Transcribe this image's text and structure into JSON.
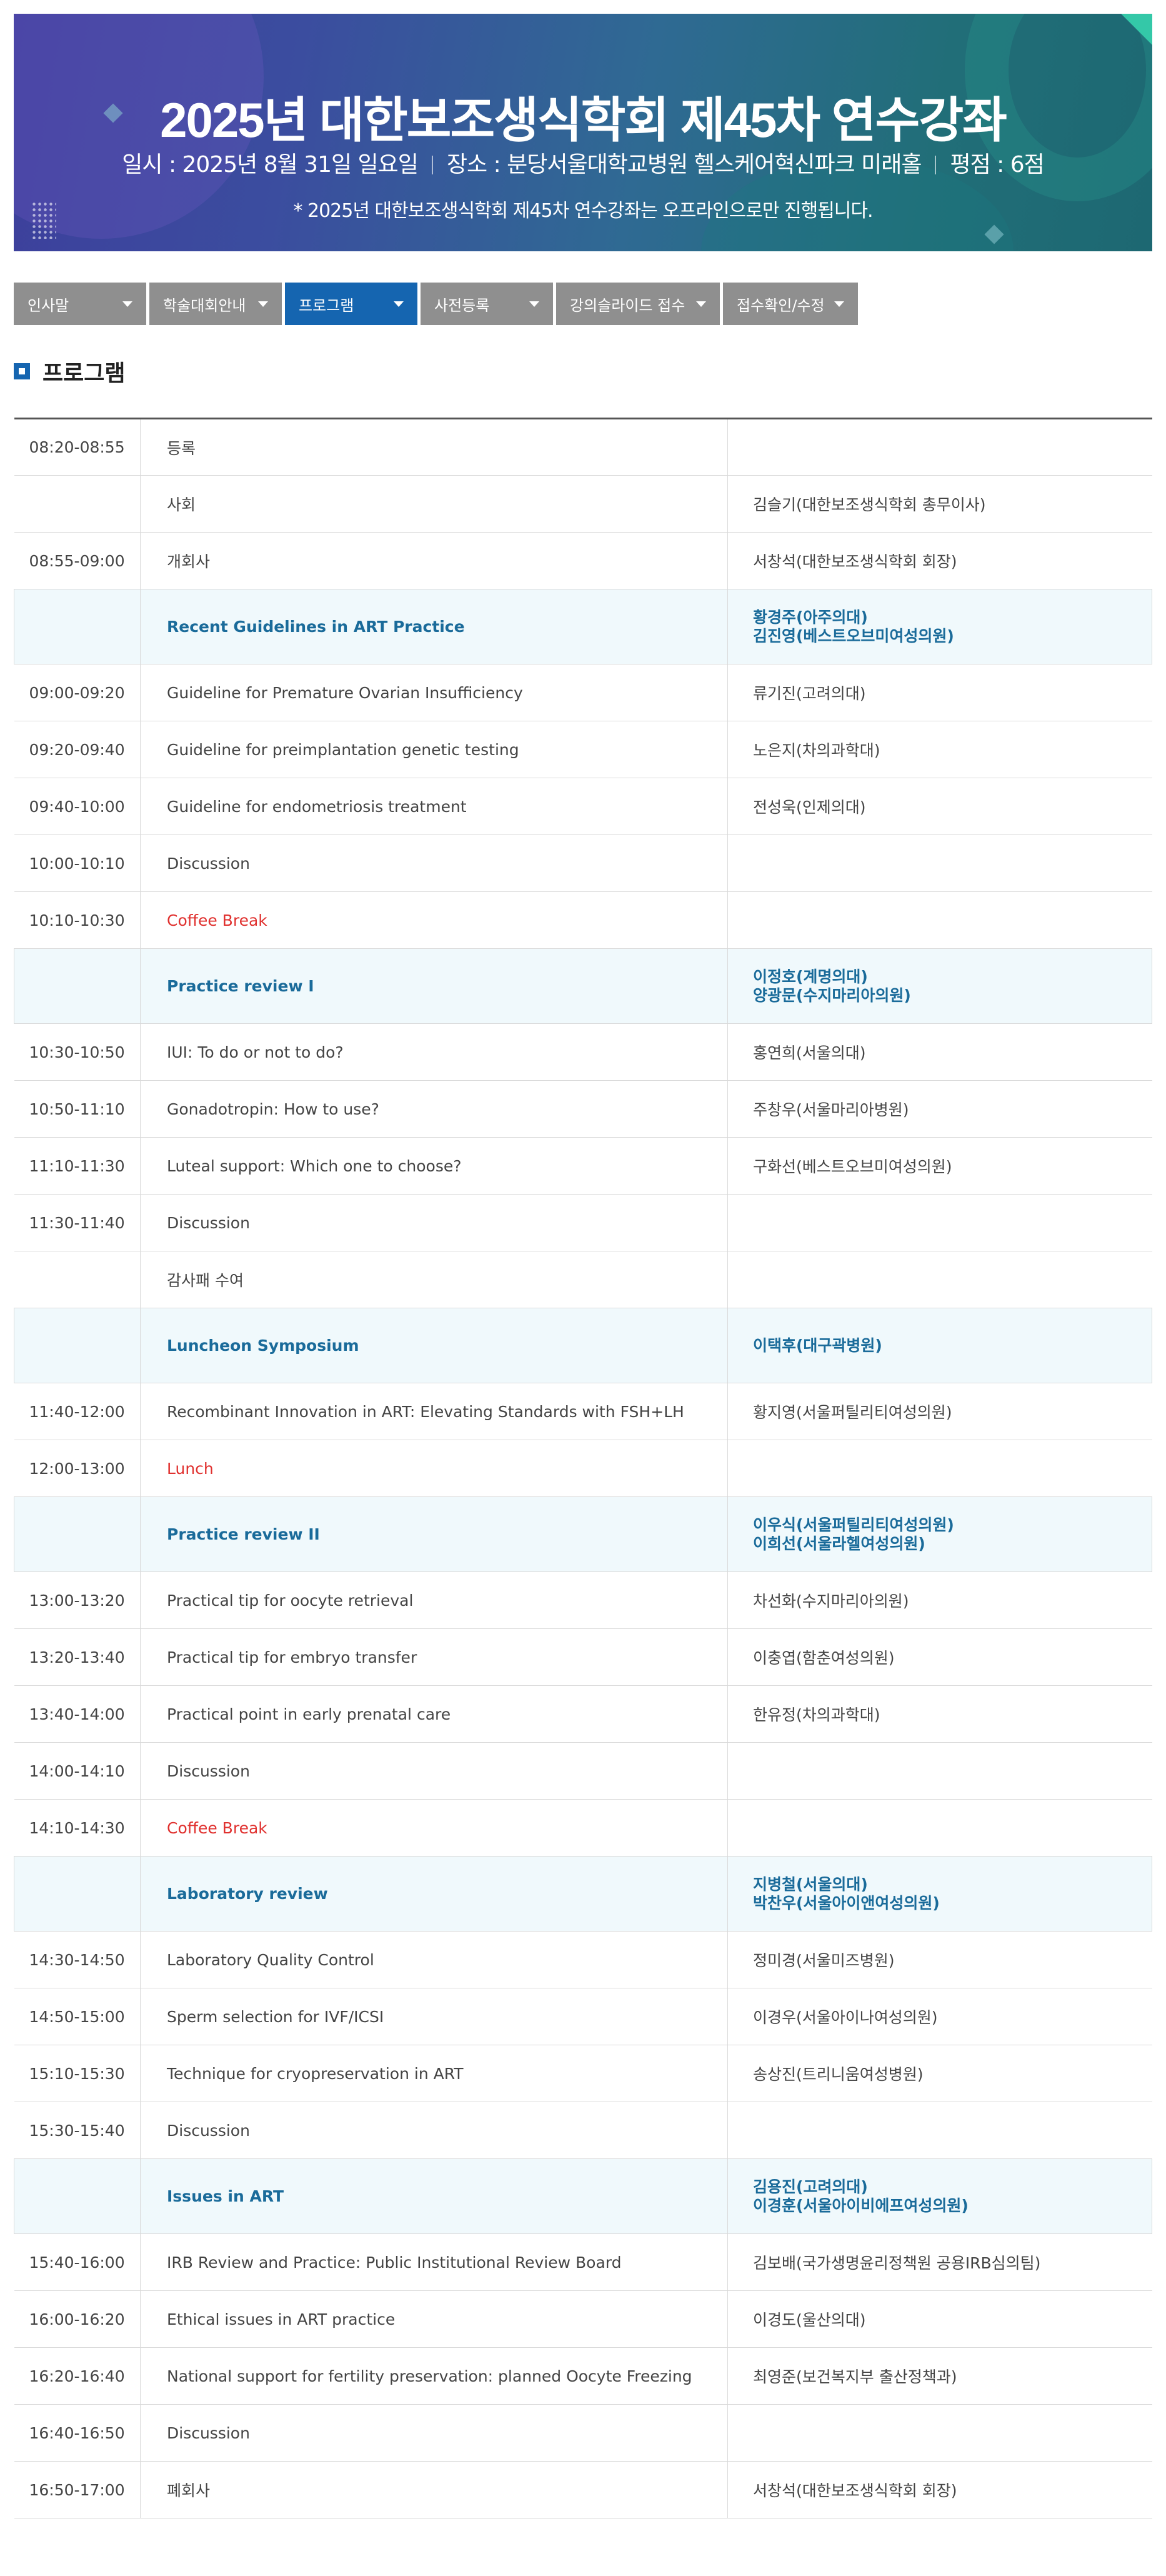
{
  "banner": {
    "title": "2025년 대한보조생식학회 제45차 연수강좌",
    "date": "일시 : 2025년 8월 31일 일요일",
    "venue": "장소 : 분당서울대학교병원 헬스케어혁신파크 미래홀",
    "score": "평점 : 6점",
    "note": "* 2025년 대한보조생식학회 제45차 연수강좌는 오프라인으로만 진행됩니다."
  },
  "nav": [
    {
      "label": "인사말",
      "active": false
    },
    {
      "label": "학술대회안내",
      "active": false
    },
    {
      "label": "프로그램",
      "active": true
    },
    {
      "label": "사전등록",
      "active": false
    },
    {
      "label": "강의슬라이드 접수",
      "active": false
    },
    {
      "label": "접수확인/수정",
      "active": false
    }
  ],
  "section_title": "프로그램",
  "colors": {
    "accent": "#1565b0",
    "session_bg": "#f0f9fc",
    "session_text": "#1a6b9a",
    "break_text": "#e0312f"
  },
  "program": [
    {
      "time": "08:20-08:55",
      "title": "등록",
      "speakers": [],
      "type": "normal"
    },
    {
      "time": "",
      "title": "사회",
      "speakers": [
        "김슬기(대한보조생식학회 총무이사)"
      ],
      "type": "normal"
    },
    {
      "time": "08:55-09:00",
      "title": "개회사",
      "speakers": [
        "서창석(대한보조생식학회 회장)"
      ],
      "type": "normal"
    },
    {
      "time": "",
      "title": "Recent Guidelines in ART Practice",
      "speakers": [
        "황경주(아주의대)",
        "김진영(베스트오브미여성의원)"
      ],
      "type": "session"
    },
    {
      "time": "09:00-09:20",
      "title": "Guideline for Premature Ovarian Insufficiency",
      "speakers": [
        "류기진(고려의대)"
      ],
      "type": "normal"
    },
    {
      "time": "09:20-09:40",
      "title": "Guideline for preimplantation genetic testing",
      "speakers": [
        "노은지(차의과학대)"
      ],
      "type": "normal"
    },
    {
      "time": "09:40-10:00",
      "title": "Guideline for endometriosis treatment",
      "speakers": [
        "전성욱(인제의대)"
      ],
      "type": "normal"
    },
    {
      "time": "10:00-10:10",
      "title": "Discussion",
      "speakers": [],
      "type": "normal"
    },
    {
      "time": "10:10-10:30",
      "title": "Coffee Break",
      "speakers": [],
      "type": "break"
    },
    {
      "time": "",
      "title": "Practice review I",
      "speakers": [
        "이정호(계명의대)",
        "양광문(수지마리아의원)"
      ],
      "type": "session"
    },
    {
      "time": "10:30-10:50",
      "title": "IUI: To do or not to do?",
      "speakers": [
        "홍연희(서울의대)"
      ],
      "type": "normal"
    },
    {
      "time": "10:50-11:10",
      "title": "Gonadotropin: How to use?",
      "speakers": [
        "주창우(서울마리아병원)"
      ],
      "type": "normal"
    },
    {
      "time": "11:10-11:30",
      "title": "Luteal support: Which one to choose?",
      "speakers": [
        "구화선(베스트오브미여성의원)"
      ],
      "type": "normal"
    },
    {
      "time": "11:30-11:40",
      "title": "Discussion",
      "speakers": [],
      "type": "normal"
    },
    {
      "time": "",
      "title": "감사패 수여",
      "speakers": [],
      "type": "normal"
    },
    {
      "time": "",
      "title": "Luncheon Symposium",
      "speakers": [
        "이택후(대구곽병원)"
      ],
      "type": "session"
    },
    {
      "time": "11:40-12:00",
      "title": "Recombinant Innovation in ART: Elevating Standards with FSH+LH",
      "speakers": [
        "황지영(서울퍼틸리티여성의원)"
      ],
      "type": "normal"
    },
    {
      "time": "12:00-13:00",
      "title": "Lunch",
      "speakers": [],
      "type": "break"
    },
    {
      "time": "",
      "title": "Practice review II",
      "speakers": [
        "이우식(서울퍼틸리티여성의원)",
        "이희선(서울라헬여성의원)"
      ],
      "type": "session"
    },
    {
      "time": "13:00-13:20",
      "title": "Practical tip for oocyte retrieval",
      "speakers": [
        "차선화(수지마리아의원)"
      ],
      "type": "normal"
    },
    {
      "time": "13:20-13:40",
      "title": "Practical tip for embryo transfer",
      "speakers": [
        "이충엽(함춘여성의원)"
      ],
      "type": "normal"
    },
    {
      "time": "13:40-14:00",
      "title": "Practical point in early prenatal care",
      "speakers": [
        "한유정(차의과학대)"
      ],
      "type": "normal"
    },
    {
      "time": "14:00-14:10",
      "title": "Discussion",
      "speakers": [],
      "type": "normal"
    },
    {
      "time": "14:10-14:30",
      "title": "Coffee Break",
      "speakers": [],
      "type": "break"
    },
    {
      "time": "",
      "title": "Laboratory review",
      "speakers": [
        "지병철(서울의대)",
        "박찬우(서울아이앤여성의원)"
      ],
      "type": "session"
    },
    {
      "time": "14:30-14:50",
      "title": "Laboratory Quality Control",
      "speakers": [
        "정미경(서울미즈병원)"
      ],
      "type": "normal"
    },
    {
      "time": "14:50-15:00",
      "title": "Sperm selection for IVF/ICSI",
      "speakers": [
        "이경우(서울아이나여성의원)"
      ],
      "type": "normal"
    },
    {
      "time": "15:10-15:30",
      "title": "Technique for cryopreservation in ART",
      "speakers": [
        "송상진(트리니움여성병원)"
      ],
      "type": "normal"
    },
    {
      "time": "15:30-15:40",
      "title": "Discussion",
      "speakers": [],
      "type": "normal"
    },
    {
      "time": "",
      "title": "Issues in ART",
      "speakers": [
        "김용진(고려의대)",
        "이경훈(서울아이비에프여성의원)"
      ],
      "type": "session"
    },
    {
      "time": "15:40-16:00",
      "title": "IRB Review and Practice: Public Institutional Review Board",
      "speakers": [
        "김보배(국가생명윤리정책원 공용IRB심의팀)"
      ],
      "type": "normal"
    },
    {
      "time": "16:00-16:20",
      "title": "Ethical issues in ART practice",
      "speakers": [
        "이경도(울산의대)"
      ],
      "type": "normal"
    },
    {
      "time": "16:20-16:40",
      "title": "National support for fertility preservation: planned Oocyte Freezing",
      "speakers": [
        "최영준(보건복지부 출산정책과)"
      ],
      "type": "normal"
    },
    {
      "time": "16:40-16:50",
      "title": "Discussion",
      "speakers": [],
      "type": "normal"
    },
    {
      "time": "16:50-17:00",
      "title": "폐회사",
      "speakers": [
        "서창석(대한보조생식학회 회장)"
      ],
      "type": "normal"
    }
  ]
}
